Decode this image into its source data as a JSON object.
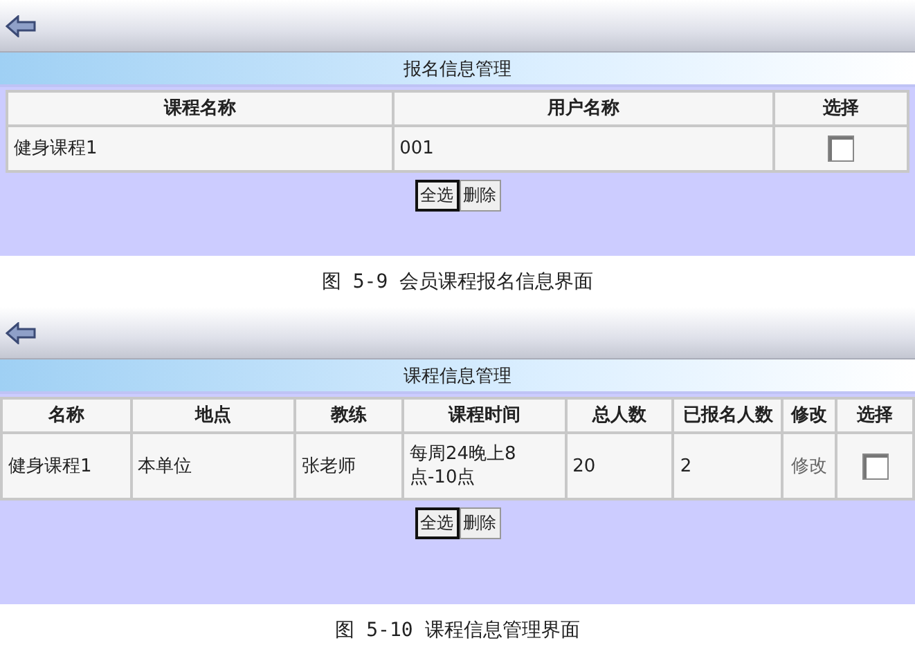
{
  "figures": [
    {
      "panel_title": "报名信息管理",
      "columns": [
        "课程名称",
        "用户名称",
        "选择"
      ],
      "rows": [
        {
          "cells": [
            {
              "kind": "text",
              "text": "健身课程1"
            },
            {
              "kind": "text",
              "text": "001"
            },
            {
              "kind": "checkbox",
              "checked": false
            }
          ]
        }
      ],
      "buttons": [
        {
          "label": "全选",
          "focused": true
        },
        {
          "label": "删除",
          "focused": false
        }
      ],
      "caption": "图 5-9 会员课程报名信息界面"
    },
    {
      "panel_title": "课程信息管理",
      "columns": [
        "名称",
        "地点",
        "教练",
        "课程时间",
        "总人数",
        "已报名人数",
        "修改",
        "选择"
      ],
      "rows": [
        {
          "cells": [
            {
              "kind": "text",
              "text": "健身课程1"
            },
            {
              "kind": "text",
              "text": "本单位"
            },
            {
              "kind": "text",
              "text": "张老师"
            },
            {
              "kind": "text",
              "text": "每周24晚上8点-10点"
            },
            {
              "kind": "text",
              "text": "20"
            },
            {
              "kind": "text",
              "text": "2"
            },
            {
              "kind": "link",
              "text": "修改"
            },
            {
              "kind": "checkbox",
              "checked": false
            }
          ]
        }
      ],
      "buttons": [
        {
          "label": "全选",
          "focused": true
        },
        {
          "label": "删除",
          "focused": false
        }
      ],
      "caption": "图 5-10 课程信息管理界面"
    }
  ]
}
